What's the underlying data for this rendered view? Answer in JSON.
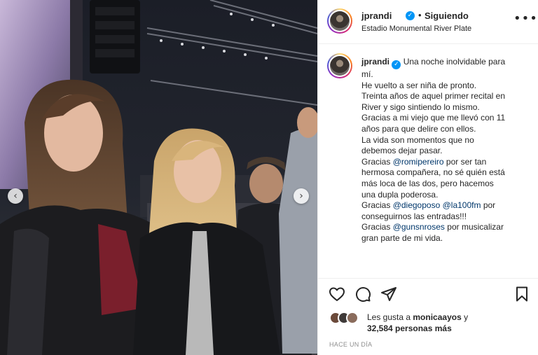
{
  "post": {
    "username": "jprandi",
    "verified_mark": "✓",
    "separator": "•",
    "follow_status": "Siguiendo",
    "location": "Estadio Monumental River Plate",
    "more_icon": "more-options-icon",
    "more_label": "•••"
  },
  "caption": {
    "username": "jprandi",
    "lines": [
      [
        "",
        "Una noche inolvidable para"
      ],
      [
        "mí."
      ],
      [
        "He vuelto a ser niña de pronto."
      ],
      [
        "Treinta años de aquel primer recital en"
      ],
      [
        "River y sigo sintiendo lo mismo."
      ],
      [
        "Gracias a mi viejo que me llevó con 11"
      ],
      [
        "años para que delire con ellos."
      ],
      [
        "La vida son momentos que no"
      ],
      [
        "debemos dejar pasar."
      ]
    ],
    "thanks1_prefix": "Gracias",
    "thanks1_mention": "@romipereiro",
    "thanks1_rest": "por ser tan",
    "thanks1_line2": "hermosa compañera, no sé quién está",
    "thanks1_line3": "más loca de las dos, pero hacemos",
    "thanks1_line4": "una dupla poderosa.",
    "thanks2_prefix": "Gracias",
    "thanks2_mention1": "@diegoposo",
    "thanks2_mention2": "@la100fm",
    "thanks2_rest": "por",
    "thanks2_line2": "conseguirnos las entradas!!!",
    "thanks3_prefix": "Gracias",
    "thanks3_mention": "@gunsnroses",
    "thanks3_rest": "por musicalizar",
    "thanks3_line2": "gran parte de mi vida."
  },
  "caption_line1": "Una noche inolvidable para",
  "caption_text": {
    "l2": "mí.",
    "l3": "He vuelto a ser niña de pronto.",
    "l4": "Treinta años de aquel primer recital en",
    "l5": "River y sigo sintiendo lo mismo.",
    "l6": "Gracias a mi viejo que me llevó con 11",
    "l7": "años para que delire con ellos.",
    "l8": "La vida son momentos que no",
    "l9": "debemos dejar pasar."
  },
  "likes": {
    "prefix": "Les gusta a",
    "user": "monicaayos",
    "connector": "y",
    "count": "32,584 personas más"
  },
  "timestamp": "HACE UN DÍA",
  "nav": {
    "prev": "‹",
    "next": "›"
  },
  "icons": [
    "heart-icon",
    "comment-icon",
    "share-icon",
    "bookmark-icon"
  ],
  "colors": {
    "verified": "#0095f6",
    "mention": "#00376b",
    "muted": "#8e8e8e"
  }
}
